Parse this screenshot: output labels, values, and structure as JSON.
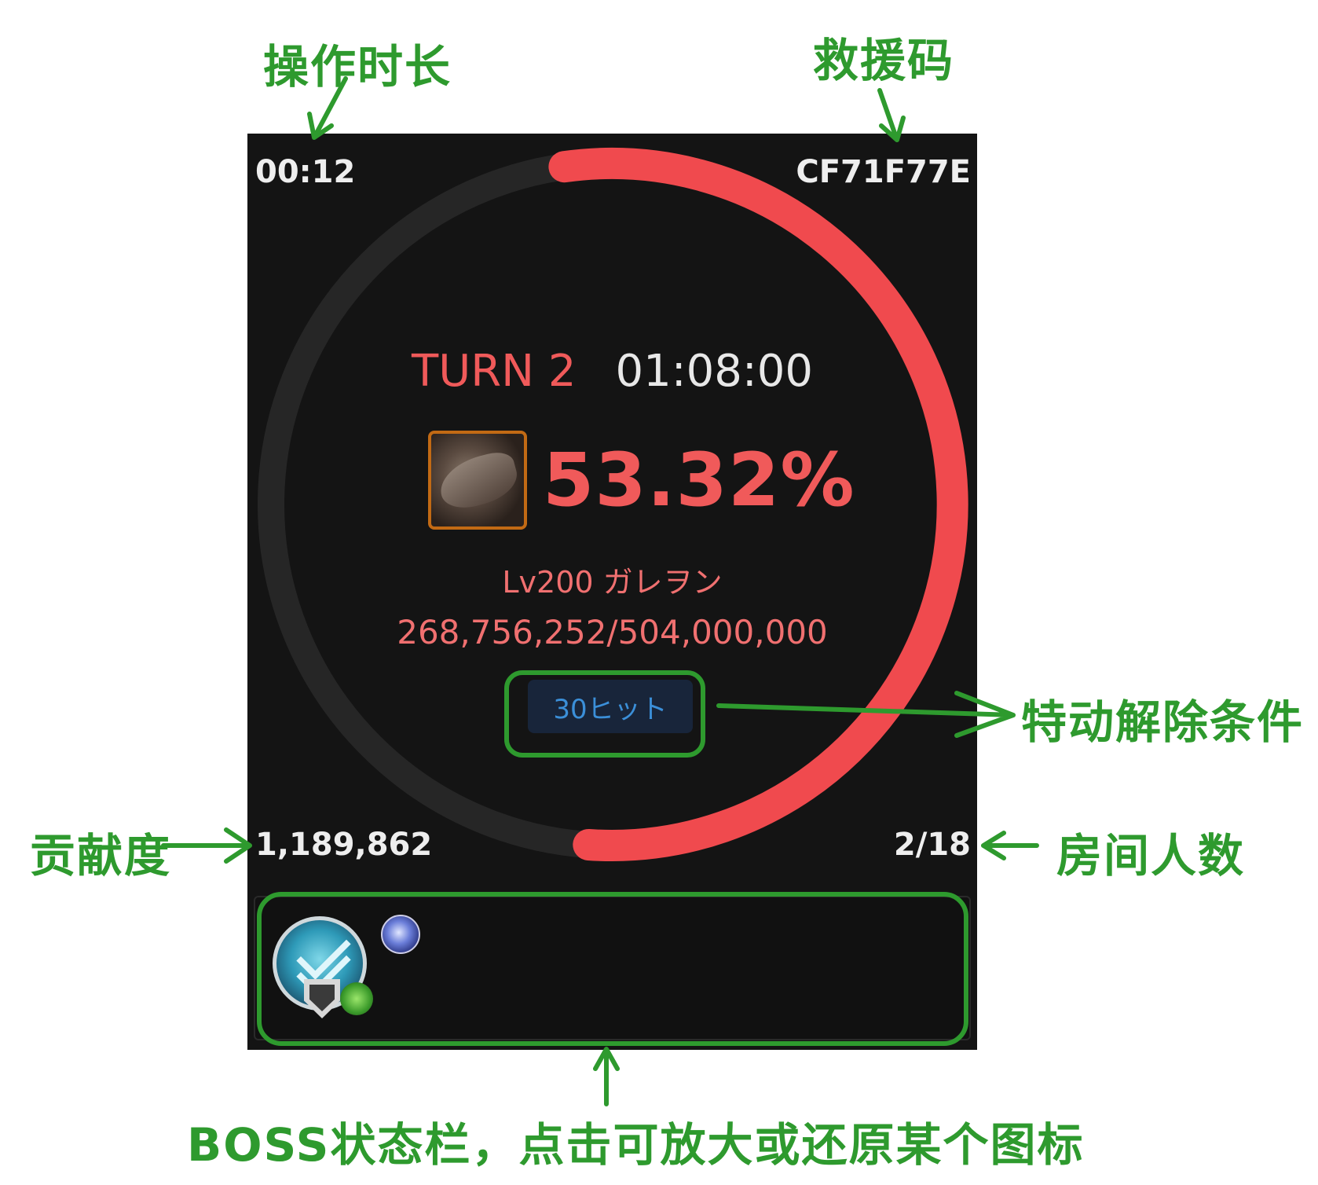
{
  "annotations": {
    "operation_time": "操作时长",
    "rescue_code": "救援码",
    "unlock_condition": "特动解除条件",
    "contribution": "贡献度",
    "room_count": "房间人数",
    "boss_status_bar": "BOSS状态栏，点击可放大或还原某个图标"
  },
  "battle": {
    "elapsed": "00:12",
    "rescue_code": "CF71F77E",
    "turn": "TURN 2",
    "remaining_time": "01:08:00",
    "hp_percent": "53.32%",
    "hp_fraction": 0.5332,
    "boss_name": "Lv200 ガレヲン",
    "boss_hp": "268,756,252/504,000,000",
    "unlock_hits": "30ヒット",
    "contribution": "1,189,862",
    "room_players": "2/18"
  },
  "colors": {
    "hp_arc": "#f04a4e",
    "ring_track": "#262626",
    "annotation": "#2e9a2e"
  },
  "status_icons": [
    "defense-down-icon",
    "shield-icon",
    "green-effect-icon",
    "element-debuff-icon"
  ]
}
